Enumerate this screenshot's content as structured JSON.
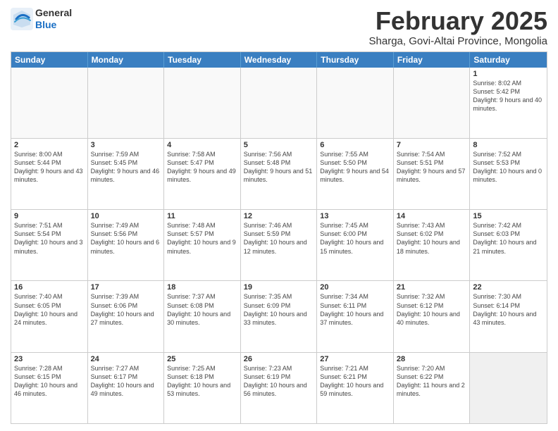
{
  "header": {
    "logo_general": "General",
    "logo_blue": "Blue",
    "month_title": "February 2025",
    "subtitle": "Sharga, Govi-Altai Province, Mongolia"
  },
  "weekdays": [
    "Sunday",
    "Monday",
    "Tuesday",
    "Wednesday",
    "Thursday",
    "Friday",
    "Saturday"
  ],
  "weeks": [
    [
      {
        "day": "",
        "info": ""
      },
      {
        "day": "",
        "info": ""
      },
      {
        "day": "",
        "info": ""
      },
      {
        "day": "",
        "info": ""
      },
      {
        "day": "",
        "info": ""
      },
      {
        "day": "",
        "info": ""
      },
      {
        "day": "1",
        "info": "Sunrise: 8:02 AM\nSunset: 5:42 PM\nDaylight: 9 hours and 40 minutes."
      }
    ],
    [
      {
        "day": "2",
        "info": "Sunrise: 8:00 AM\nSunset: 5:44 PM\nDaylight: 9 hours and 43 minutes."
      },
      {
        "day": "3",
        "info": "Sunrise: 7:59 AM\nSunset: 5:45 PM\nDaylight: 9 hours and 46 minutes."
      },
      {
        "day": "4",
        "info": "Sunrise: 7:58 AM\nSunset: 5:47 PM\nDaylight: 9 hours and 49 minutes."
      },
      {
        "day": "5",
        "info": "Sunrise: 7:56 AM\nSunset: 5:48 PM\nDaylight: 9 hours and 51 minutes."
      },
      {
        "day": "6",
        "info": "Sunrise: 7:55 AM\nSunset: 5:50 PM\nDaylight: 9 hours and 54 minutes."
      },
      {
        "day": "7",
        "info": "Sunrise: 7:54 AM\nSunset: 5:51 PM\nDaylight: 9 hours and 57 minutes."
      },
      {
        "day": "8",
        "info": "Sunrise: 7:52 AM\nSunset: 5:53 PM\nDaylight: 10 hours and 0 minutes."
      }
    ],
    [
      {
        "day": "9",
        "info": "Sunrise: 7:51 AM\nSunset: 5:54 PM\nDaylight: 10 hours and 3 minutes."
      },
      {
        "day": "10",
        "info": "Sunrise: 7:49 AM\nSunset: 5:56 PM\nDaylight: 10 hours and 6 minutes."
      },
      {
        "day": "11",
        "info": "Sunrise: 7:48 AM\nSunset: 5:57 PM\nDaylight: 10 hours and 9 minutes."
      },
      {
        "day": "12",
        "info": "Sunrise: 7:46 AM\nSunset: 5:59 PM\nDaylight: 10 hours and 12 minutes."
      },
      {
        "day": "13",
        "info": "Sunrise: 7:45 AM\nSunset: 6:00 PM\nDaylight: 10 hours and 15 minutes."
      },
      {
        "day": "14",
        "info": "Sunrise: 7:43 AM\nSunset: 6:02 PM\nDaylight: 10 hours and 18 minutes."
      },
      {
        "day": "15",
        "info": "Sunrise: 7:42 AM\nSunset: 6:03 PM\nDaylight: 10 hours and 21 minutes."
      }
    ],
    [
      {
        "day": "16",
        "info": "Sunrise: 7:40 AM\nSunset: 6:05 PM\nDaylight: 10 hours and 24 minutes."
      },
      {
        "day": "17",
        "info": "Sunrise: 7:39 AM\nSunset: 6:06 PM\nDaylight: 10 hours and 27 minutes."
      },
      {
        "day": "18",
        "info": "Sunrise: 7:37 AM\nSunset: 6:08 PM\nDaylight: 10 hours and 30 minutes."
      },
      {
        "day": "19",
        "info": "Sunrise: 7:35 AM\nSunset: 6:09 PM\nDaylight: 10 hours and 33 minutes."
      },
      {
        "day": "20",
        "info": "Sunrise: 7:34 AM\nSunset: 6:11 PM\nDaylight: 10 hours and 37 minutes."
      },
      {
        "day": "21",
        "info": "Sunrise: 7:32 AM\nSunset: 6:12 PM\nDaylight: 10 hours and 40 minutes."
      },
      {
        "day": "22",
        "info": "Sunrise: 7:30 AM\nSunset: 6:14 PM\nDaylight: 10 hours and 43 minutes."
      }
    ],
    [
      {
        "day": "23",
        "info": "Sunrise: 7:28 AM\nSunset: 6:15 PM\nDaylight: 10 hours and 46 minutes."
      },
      {
        "day": "24",
        "info": "Sunrise: 7:27 AM\nSunset: 6:17 PM\nDaylight: 10 hours and 49 minutes."
      },
      {
        "day": "25",
        "info": "Sunrise: 7:25 AM\nSunset: 6:18 PM\nDaylight: 10 hours and 53 minutes."
      },
      {
        "day": "26",
        "info": "Sunrise: 7:23 AM\nSunset: 6:19 PM\nDaylight: 10 hours and 56 minutes."
      },
      {
        "day": "27",
        "info": "Sunrise: 7:21 AM\nSunset: 6:21 PM\nDaylight: 10 hours and 59 minutes."
      },
      {
        "day": "28",
        "info": "Sunrise: 7:20 AM\nSunset: 6:22 PM\nDaylight: 11 hours and 2 minutes."
      },
      {
        "day": "",
        "info": ""
      }
    ]
  ]
}
